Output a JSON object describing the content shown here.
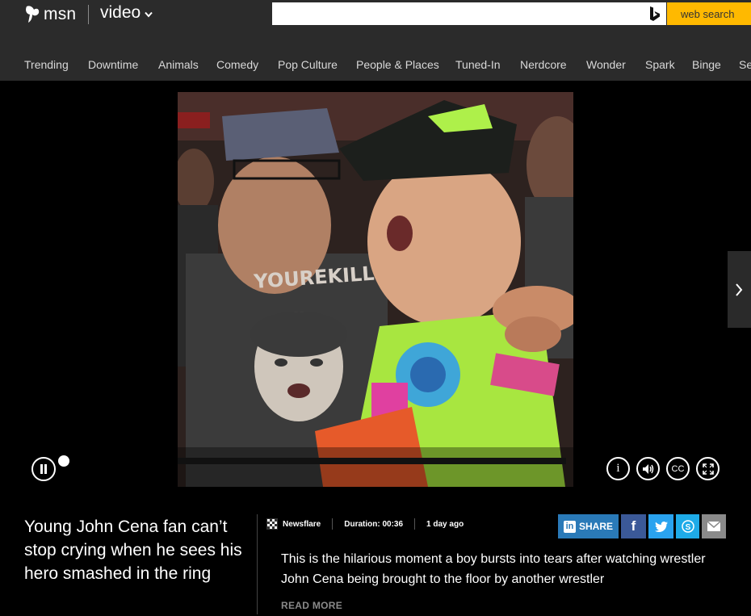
{
  "header": {
    "brand": "msn",
    "section": "video",
    "search": {
      "placeholder": "",
      "value": "",
      "button_label": "web search"
    },
    "nav": [
      "Trending",
      "Downtime",
      "Animals",
      "Comedy",
      "Pop Culture",
      "People & Places",
      "Tuned-In",
      "Nerdcore",
      "Wonder",
      "Spark",
      "Binge",
      "Se"
    ]
  },
  "player": {
    "captions_label": "CC",
    "info_label": "i",
    "state": "playing",
    "progress": 0.0
  },
  "video": {
    "title": "Young John Cena fan can’t stop crying when he sees his hero smashed in the ring",
    "provider": "Newsflare",
    "duration": "Duration: 00:36",
    "posted": "1 day ago",
    "description": "This is the hilarious moment a boy bursts into tears after watching wrestler John Cena being brought to the floor by another wrestler",
    "read_more": "READ MORE"
  },
  "share": {
    "label": "SHARE",
    "networks": [
      "linkedin",
      "facebook",
      "twitter",
      "skype",
      "email"
    ]
  },
  "colors": {
    "topbar": "#2b2b2b",
    "search_button": "#ffb900",
    "linkedin": "#2a7ab8",
    "facebook": "#3b5998",
    "twitter": "#2aa3ef",
    "skype": "#1eabe8",
    "email": "#8a8a8a"
  }
}
